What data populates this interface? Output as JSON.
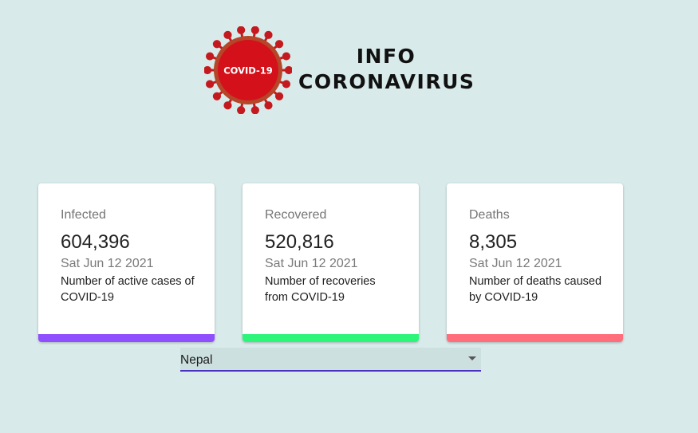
{
  "header": {
    "logo_badge": "COVID-19",
    "title_line1": "INFO",
    "title_line2": "CORONAVIRUS"
  },
  "cards": [
    {
      "title": "Infected",
      "value": "604,396",
      "date": "Sat Jun 12 2021",
      "description": "Number of active cases of COVID-19",
      "accent_color": "#8f4fff"
    },
    {
      "title": "Recovered",
      "value": "520,816",
      "date": "Sat Jun 12 2021",
      "description": "Number of recoveries from COVID-19",
      "accent_color": "#2cf57a"
    },
    {
      "title": "Deaths",
      "value": "8,305",
      "date": "Sat Jun 12 2021",
      "description": "Number of deaths caused by COVID-19",
      "accent_color": "#ff6e7a"
    }
  ],
  "country_select": {
    "selected": "Nepal",
    "icon": "dropdown-arrow-icon"
  },
  "colors": {
    "background": "#d9eaea",
    "virus_red": "#cc1b1b",
    "select_underline": "#4b32c3"
  }
}
